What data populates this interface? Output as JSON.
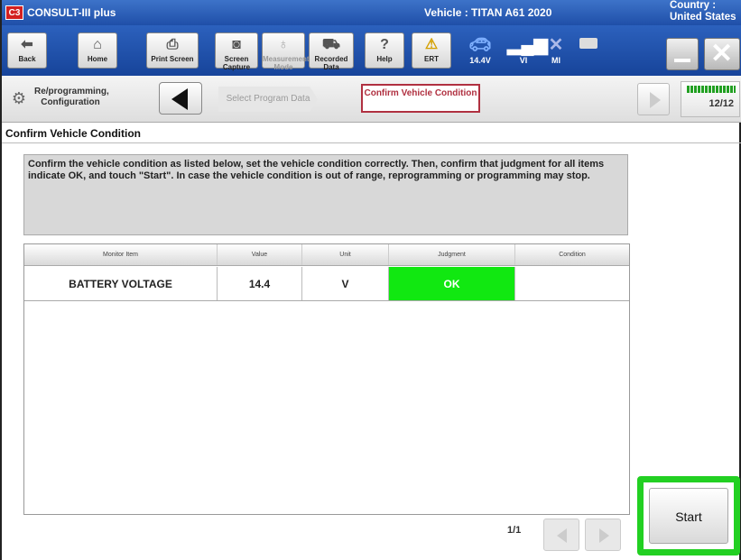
{
  "app": {
    "title": "CONSULT-III plus",
    "logo": "C3"
  },
  "vehicle_info": "Vehicle : TITAN A61 2020",
  "country_info": "Country : United States",
  "toolbar": {
    "back": "Back",
    "home": "Home",
    "print_screen": "Print Screen",
    "screen_capture": "Screen Capture",
    "measurement_mode": "Measurement Mode",
    "recorded_data": "Recorded Data",
    "help": "Help",
    "ert": "ERT",
    "voltage": "14.4V",
    "vi": "VI",
    "mi": "MI"
  },
  "breadcrumb": {
    "section": "Re/programming, Configuration",
    "step_prev": "Select Program Data",
    "step_current": "Confirm Vehicle Condition",
    "progress": "12/12"
  },
  "page_title": "Confirm Vehicle Condition",
  "instructions": "Confirm the vehicle condition as listed below, set the vehicle condition correctly. Then, confirm that judgment for all items indicate OK, and touch \"Start\". In case the vehicle condition is out of range, reprogramming or programming may stop.",
  "table": {
    "headers": [
      "Monitor Item",
      "Value",
      "Unit",
      "Judgment",
      "Condition"
    ],
    "rows": [
      {
        "item": "BATTERY VOLTAGE",
        "value": "14.4",
        "unit": "V",
        "judgment": "OK",
        "condition": ""
      }
    ]
  },
  "pager": "1/1",
  "start_label": "Start",
  "colors": {
    "title_bar": "#2c61bd",
    "ok_green": "#11e811",
    "highlight": "#22d022",
    "active_step": "#b03040"
  }
}
